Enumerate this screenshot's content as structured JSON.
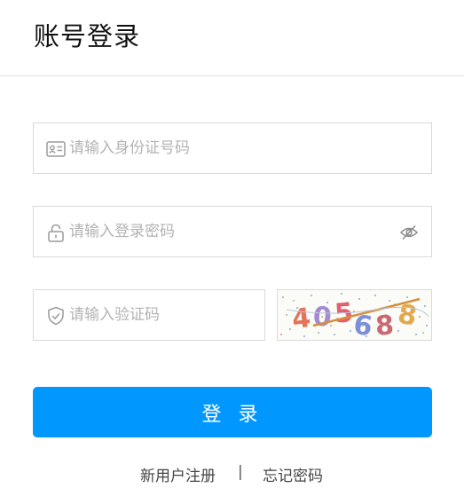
{
  "header": {
    "title": "账号登录"
  },
  "form": {
    "id_placeholder": "请输入身份证号码",
    "password_placeholder": "请输入登录密码",
    "captcha_placeholder": "请输入验证码",
    "captcha_text": "405688",
    "login_label": "登 录"
  },
  "footer": {
    "register_label": "新用户注册",
    "separator": "|",
    "forgot_label": "忘记密码"
  },
  "icons": {
    "id_field": "id-card-icon",
    "password_field": "lock-icon",
    "password_toggle": "eye-off-icon",
    "captcha_field": "shield-icon"
  },
  "colors": {
    "primary": "#0097ff",
    "border": "#d9d9d9",
    "placeholder": "#b3b3b3"
  }
}
